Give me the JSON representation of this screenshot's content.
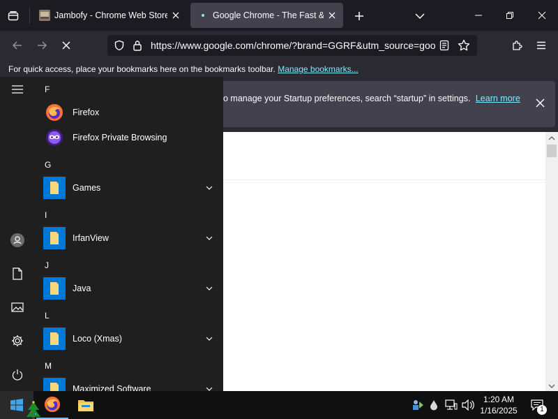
{
  "browser": {
    "tabs": [
      {
        "title": "Jambofy - Chrome Web Store",
        "active": false
      },
      {
        "title": "Google Chrome - The Fast & Se",
        "active": true
      }
    ],
    "url": "https://www.google.com/chrome/?brand=GGRF&utm_source=goo",
    "bookmarks_bar": {
      "text": "For quick access, place your bookmarks here on the bookmarks toolbar.",
      "link": "Manage bookmarks..."
    },
    "notification": {
      "text": "o manage your Startup preferences, search “startup” in settings.",
      "link": "Learn more"
    }
  },
  "start_menu": {
    "sections": [
      {
        "letter": "F",
        "apps": [
          {
            "name": "Firefox",
            "icon": "firefox-icon",
            "expandable": false
          },
          {
            "name": "Firefox Private Browsing",
            "icon": "firefox-private-icon",
            "expandable": false
          }
        ]
      },
      {
        "letter": "G",
        "apps": [
          {
            "name": "Games",
            "icon": "folder-icon",
            "expandable": true
          }
        ]
      },
      {
        "letter": "I",
        "apps": [
          {
            "name": "IrfanView",
            "icon": "folder-icon",
            "expandable": true
          }
        ]
      },
      {
        "letter": "J",
        "apps": [
          {
            "name": "Java",
            "icon": "folder-icon",
            "expandable": true
          }
        ]
      },
      {
        "letter": "L",
        "apps": [
          {
            "name": "Loco (Xmas)",
            "icon": "folder-icon",
            "expandable": true
          }
        ]
      },
      {
        "letter": "M",
        "apps": [
          {
            "name": "Maximized Software",
            "icon": "folder-icon",
            "expandable": true
          }
        ]
      }
    ]
  },
  "taskbar": {
    "time": "1:20 AM",
    "date": "1/16/2025",
    "notification_count": "1"
  },
  "colors": {
    "accent_link": "#80ebff",
    "start_tile": "#0078d7",
    "active_tab": "#42414d"
  }
}
